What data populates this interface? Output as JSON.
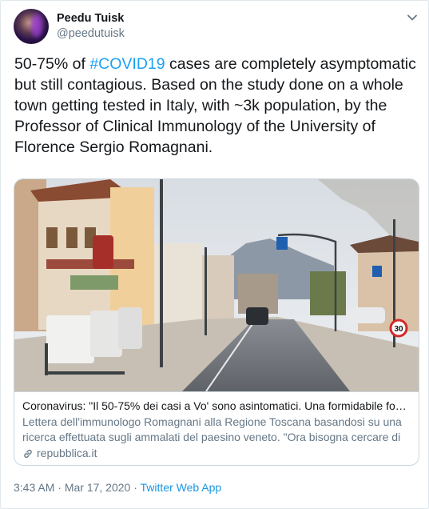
{
  "author": {
    "display_name": "Peedu Tuisk",
    "handle": "@peedutuisk"
  },
  "tweet": {
    "text_before": "50-75% of ",
    "hashtag": "#COVID19",
    "text_after": " cases are completely asymptomatic but still contagious. Based on the study done on a whole town getting tested in Italy, with ~3k population, by the Professor of Clinical Immunology of the University of Florence Sergio Romagnani."
  },
  "card": {
    "title": "Coronavirus: \"Il 50-75% dei casi a Vo' sono asintomatici. Una formidabile font…",
    "description": "Lettera dell'immunologo Romagnani alla Regione Toscana basandosi su una ricerca effettuata sugli ammalati del paesino veneto. \"Ora bisogna cercare di",
    "domain": "repubblica.it",
    "sign_text": "30"
  },
  "meta": {
    "time": "3:43 AM",
    "separator": " · ",
    "date": "Mar 17, 2020",
    "source": "Twitter Web App"
  },
  "icons": {
    "caret": "chevron-down-icon",
    "link": "link-icon"
  },
  "colors": {
    "link_blue": "#1da1f2",
    "secondary_text": "#657786",
    "border": "#ccd6dd"
  }
}
